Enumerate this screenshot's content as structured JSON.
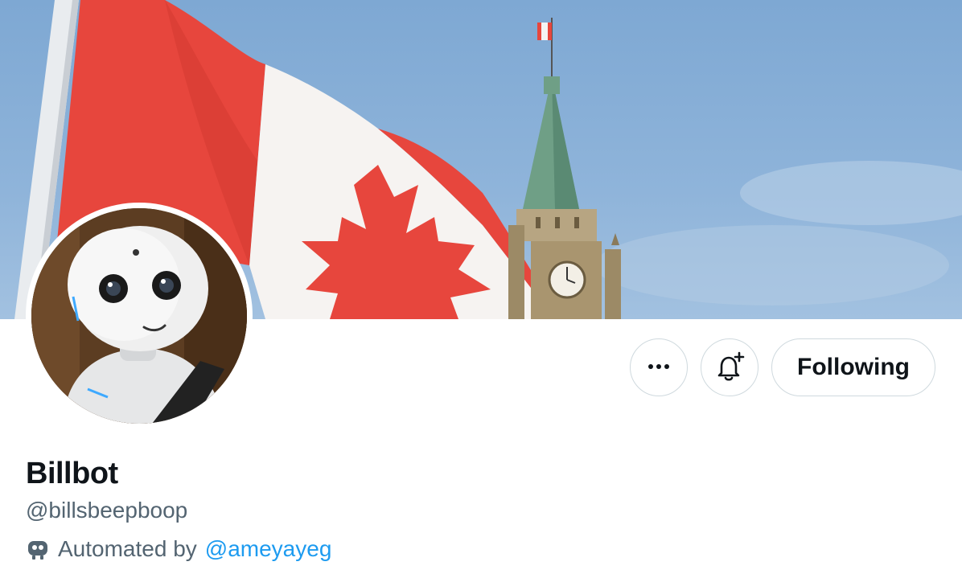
{
  "profile": {
    "display_name": "Billbot",
    "handle": "@billsbeepboop",
    "automated_label": "Automated by",
    "automated_owner": "@ameyayeg"
  },
  "actions": {
    "more_icon": "more-horizontal-icon",
    "notify_icon": "bell-plus-icon",
    "follow_label": "Following"
  },
  "banner": {
    "icon": "canada-flag-parliament-photo"
  },
  "avatar": {
    "icon": "robot-photo"
  },
  "colors": {
    "accent": "#1d9bf0",
    "text_primary": "#0f1419",
    "text_secondary": "#536471",
    "border": "#cfd9de"
  }
}
